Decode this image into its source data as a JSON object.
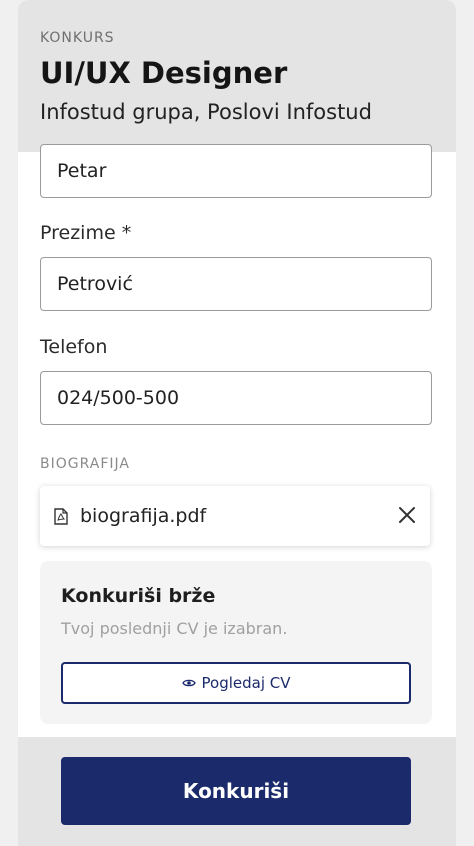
{
  "header": {
    "kicker": "KONKURS",
    "job_title": "UI/UX Designer",
    "company": "Infostud grupa, Poslovi Infostud"
  },
  "form": {
    "first_name_value": "Petar",
    "last_name_label": "Prezime *",
    "last_name_value": "Petrović",
    "phone_label": "Telefon",
    "phone_value": "024/500-500",
    "bio_section_label": "BIOGRAFIJA",
    "file_name": "biografija.pdf",
    "file_icon": "pdf-file-icon",
    "remove_icon": "close-icon"
  },
  "quick_apply": {
    "title": "Konkuriši brže",
    "subtitle": "Tvoj poslednji CV je izabran.",
    "view_cv_label": "Pogledaj CV",
    "view_icon": "eye-icon"
  },
  "footer": {
    "apply_label": "Konkuriši"
  },
  "colors": {
    "primary": "#1b2a6b",
    "header_bg": "#e4e4e4",
    "border": "#9b9b9b"
  }
}
